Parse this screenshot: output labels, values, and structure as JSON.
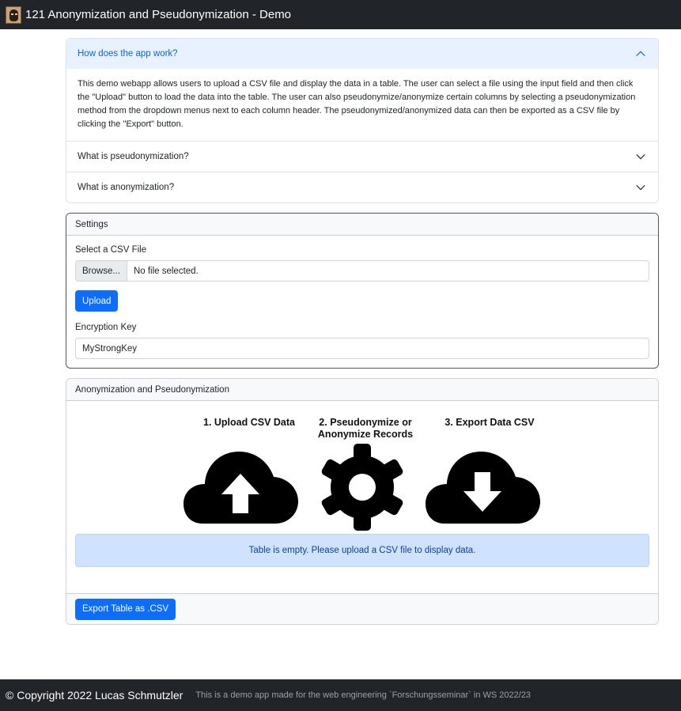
{
  "window": {
    "title": "121 Anonymization and Pseudonymization - Demo",
    "logo_icon": "user-avatar-icon"
  },
  "accordion": {
    "items": [
      {
        "title": "How does the app work?",
        "expanded": true,
        "body": "This demo webapp allows users to upload a CSV file and display the data in a table. The user can select a file using the input field and then click the \"Upload\" button to load the data into the table. The user can also pseudonymize/anonymize certain columns by selecting a pseudonymization method from the dropdown menus next to each column header. The pseudonymized/anonymized data can then be exported as a CSV file by clicking the \"Export\" button."
      },
      {
        "title": "What is pseudonymization?",
        "expanded": false
      },
      {
        "title": "What is anonymization?",
        "expanded": false
      }
    ]
  },
  "settings": {
    "header": "Settings",
    "file_label": "Select a CSV File",
    "browse_label": "Browse...",
    "file_status": "No file selected.",
    "upload_label": "Upload",
    "key_label": "Encryption Key",
    "key_value": "MyStrongKey"
  },
  "anon": {
    "header": "Anonymization and Pseudonymization",
    "steps": [
      {
        "title_line1": "1. Upload CSV Data",
        "title_line2": "",
        "icon": "cloud-upload-icon"
      },
      {
        "title_line1": "2. Pseudonymize or",
        "title_line2": "Anonymize Records",
        "icon": "gear-icon"
      },
      {
        "title_line1": "3. Export Data CSV",
        "title_line2": "",
        "icon": "cloud-download-icon"
      }
    ],
    "empty_message": "Table is empty. Please upload a CSV file to display data.",
    "export_label": "Export Table as .CSV"
  },
  "footer": {
    "copyright": "© Copyright 2022 Lucas Schmutzler",
    "note": "This is a demo app made for the web engineering `Forschungsseminar` in WS 2022/23"
  },
  "colors": {
    "primary": "#0d6efd",
    "dark": "#212529",
    "accordion_active_bg": "#e7f1ff",
    "alert_info_bg": "#cfe2ff"
  }
}
